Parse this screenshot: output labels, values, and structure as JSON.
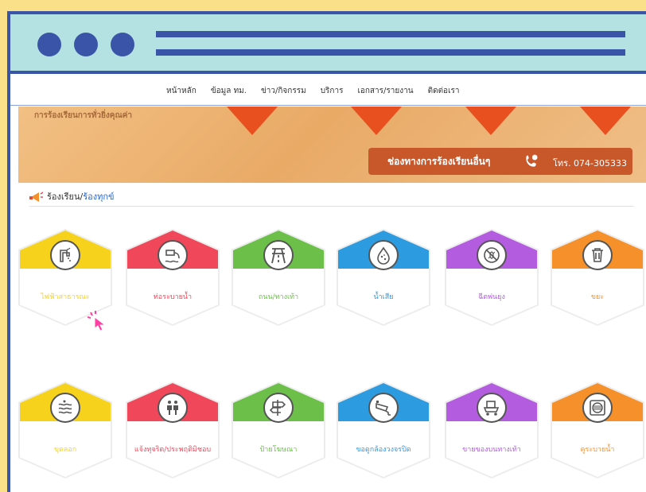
{
  "menu": [
    "หน้าหลัก",
    "ข้อมูล ทม.",
    "ข่าว/กิจกรรม",
    "บริการ",
    "เอกสาร/รายงาน",
    "ติดต่อเรา"
  ],
  "banner": {
    "text": "การร้องเรียนการทั่วยิ่งคุณค่า",
    "complain_label": "ช่องทางการร้องเรียนอื่นๆ",
    "phone": "โทร. 074-305333"
  },
  "section": {
    "title_a": "ร้องเรียน/",
    "title_b": "ร้องทุกข์"
  },
  "services": [
    {
      "label": "ไฟฟ้าสาธารณะ",
      "color": "#f6d21c",
      "icon": "water-tap-icon"
    },
    {
      "label": "ท่อระบายน้ำ",
      "color": "#f1475b",
      "icon": "drain-pipe-icon"
    },
    {
      "label": "ถนน/ทางเท้า",
      "color": "#6cc04a",
      "icon": "road-icon"
    },
    {
      "label": "น้ำเสีย",
      "color": "#2d9be0",
      "icon": "water-drop-icon"
    },
    {
      "label": "ฉีดพ่นยุง",
      "color": "#b45ce0",
      "icon": "no-mosquito-icon"
    },
    {
      "label": "ขยะ",
      "color": "#f5902a",
      "icon": "trash-icon"
    },
    {
      "label": "ขุดลอก",
      "color": "#f6d21c",
      "icon": "waves-icon"
    },
    {
      "label": "แจ้งทุจริต/ประพฤติมิชอบ",
      "color": "#f1475b",
      "icon": "people-icon"
    },
    {
      "label": "ป้ายโฆษณา",
      "color": "#6cc04a",
      "icon": "signpost-icon"
    },
    {
      "label": "ขอดูกล้องวงจรปิด",
      "color": "#2d9be0",
      "icon": "cctv-icon"
    },
    {
      "label": "ขายของบนทางเท้า",
      "color": "#b45ce0",
      "icon": "vendor-cart-icon"
    },
    {
      "label": "คูระบายน้ำ",
      "color": "#f5902a",
      "icon": "drain-grate-icon"
    }
  ]
}
